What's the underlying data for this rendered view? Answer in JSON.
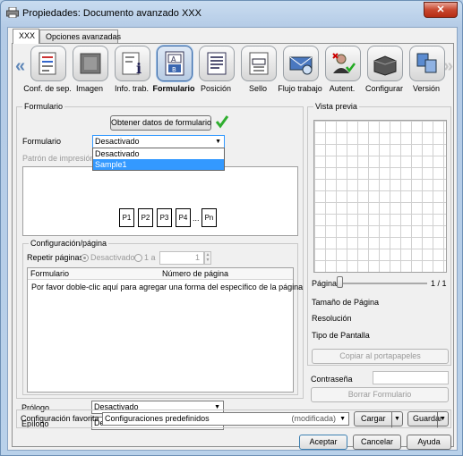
{
  "window": {
    "title": "Propiedades: Documento avanzado XXX",
    "close_label": "✕"
  },
  "tabs": [
    {
      "label": "XXX"
    },
    {
      "label": "Opciones avanzadas"
    }
  ],
  "toolbar": {
    "items": [
      {
        "label": "Conf. de sep.",
        "icon": "separator-settings-icon"
      },
      {
        "label": "Imagen",
        "icon": "image-icon"
      },
      {
        "label": "Info. trab.",
        "icon": "job-info-icon"
      },
      {
        "label": "Formulario",
        "icon": "form-overlay-icon",
        "active": true
      },
      {
        "label": "Posición",
        "icon": "position-icon"
      },
      {
        "label": "Sello",
        "icon": "stamp-icon"
      },
      {
        "label": "Flujo trabajo",
        "icon": "workflow-icon"
      },
      {
        "label": "Autent.",
        "icon": "authentication-icon"
      },
      {
        "label": "Configurar",
        "icon": "configure-icon"
      },
      {
        "label": "Versión",
        "icon": "version-icon"
      }
    ],
    "scroll_left": "«",
    "scroll_right": "»"
  },
  "form_group": {
    "title": "Formulario",
    "get_form_button": "Obtener datos de formulario",
    "form_label": "Formulario",
    "form_value": "Desactivado",
    "dropdown_options": [
      "Desactivado",
      "Sample1"
    ],
    "print_pattern_label": "Patrón de impresión",
    "pages": [
      "P1",
      "P2",
      "P3",
      "P4",
      "...",
      "Pn"
    ]
  },
  "config_group": {
    "title": "Configuración/página",
    "repeat_label": "Repetir páginas",
    "radio_off": "Desactivado",
    "radio_range_from": "1 a",
    "range_value": "1",
    "columns": [
      "Formulario",
      "Número de página"
    ],
    "hint": "Por favor doble-clic aquí para agregar una forma del específico de la página"
  },
  "prologue": {
    "label": "Prólogo",
    "value": "Desactivado"
  },
  "epilogue": {
    "label": "Epílogo",
    "value": "Desactivado"
  },
  "preview": {
    "title": "Vista previa",
    "page_label": "Página",
    "page_count": "1 / 1",
    "page_size_label": "Tamaño de Página",
    "resolution_label": "Resolución",
    "screen_type_label": "Tipo de Pantalla",
    "copy_button": "Copiar al portapapeles",
    "password_label": "Contraseña",
    "password_value": "",
    "delete_form_button": "Borrar Formulario"
  },
  "favorites": {
    "label": "Configuración favorita",
    "value": "Configuraciones predefinidos",
    "modified": "(modificada)",
    "load_button": "Cargar",
    "save_button": "Guardar"
  },
  "footer": {
    "ok": "Aceptar",
    "cancel": "Cancelar",
    "help": "Ayuda"
  },
  "colors": {
    "accent": "#3399ff",
    "check": "#2fae2f",
    "window_frame": "#b9d1ea"
  }
}
